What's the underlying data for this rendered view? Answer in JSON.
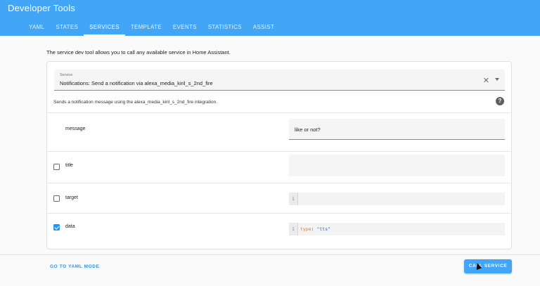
{
  "header": {
    "title": "Developer Tools",
    "tabs": [
      {
        "label": "YAML"
      },
      {
        "label": "STATES"
      },
      {
        "label": "SERVICES"
      },
      {
        "label": "TEMPLATE"
      },
      {
        "label": "EVENTS"
      },
      {
        "label": "STATISTICS"
      },
      {
        "label": "ASSIST"
      }
    ],
    "active_tab": "SERVICES"
  },
  "intro": "The service dev tool allows you to call any available service in Home Assistant.",
  "service": {
    "label": "Service",
    "value": "Notifications: Send a notification via alexa_media_kiril_s_2nd_fire",
    "description": "Sends a notification message using the alexa_media_kiril_s_2nd_fire integration."
  },
  "fields": {
    "message": {
      "name": "message",
      "value": "like or not?"
    },
    "title": {
      "name": "title",
      "checked": false,
      "value": ""
    },
    "target": {
      "name": "target",
      "checked": false,
      "line_number": "1"
    },
    "data": {
      "name": "data",
      "checked": true,
      "line_number": "1",
      "code_key": "type",
      "code_sep": ": ",
      "code_value": "\"tts\""
    }
  },
  "footer": {
    "yaml_mode_label": "GO TO YAML MODE",
    "call_service_label": "CALL SERVICE"
  },
  "colors": {
    "accent": "#42a5f5",
    "link": "#2196f3"
  }
}
